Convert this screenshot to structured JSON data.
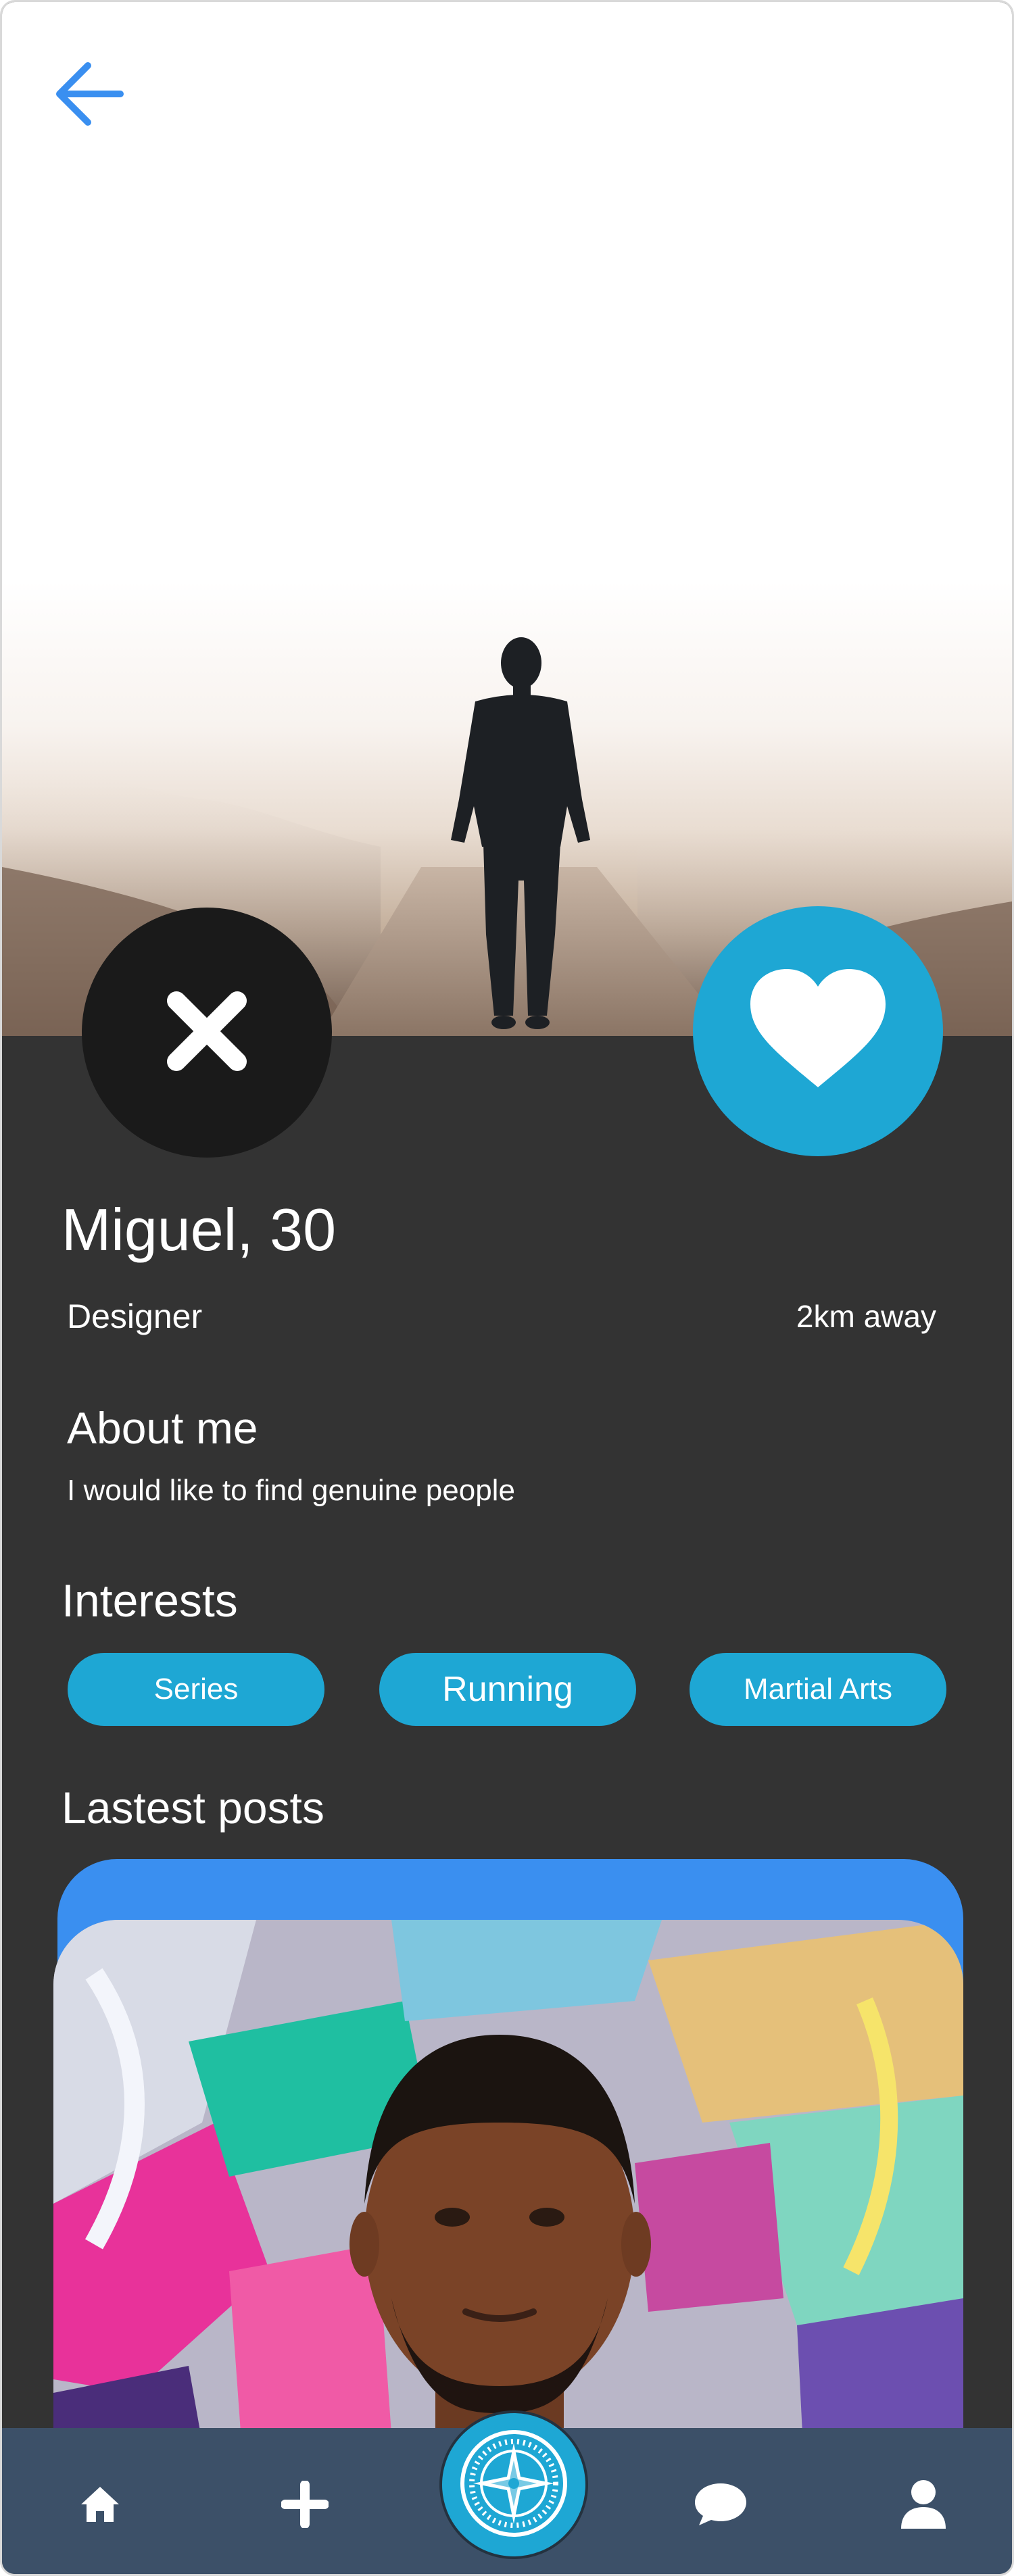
{
  "profile": {
    "name_age": "Miguel, 30",
    "occupation": "Designer",
    "distance": "2km away"
  },
  "about": {
    "title": "About me",
    "text": "I would like to find genuine people"
  },
  "interests": {
    "title": "Interests",
    "items": [
      "Series",
      "Running",
      "Martial Arts"
    ]
  },
  "posts": {
    "title": "Lastest posts"
  },
  "icons": {
    "back": "back-arrow-icon",
    "dislike": "close-x-icon",
    "like": "heart-icon",
    "home": "home-icon",
    "add": "plus-icon",
    "discover": "compass-icon",
    "chat": "chat-bubble-icon",
    "profile": "user-icon"
  },
  "colors": {
    "accent": "#1ea7d4",
    "back_arrow": "#3a8ff0",
    "background": "#333333",
    "navbar": "#3c5068",
    "dislike_button": "#1a1a1a",
    "post_card": "#3a8ff0"
  }
}
